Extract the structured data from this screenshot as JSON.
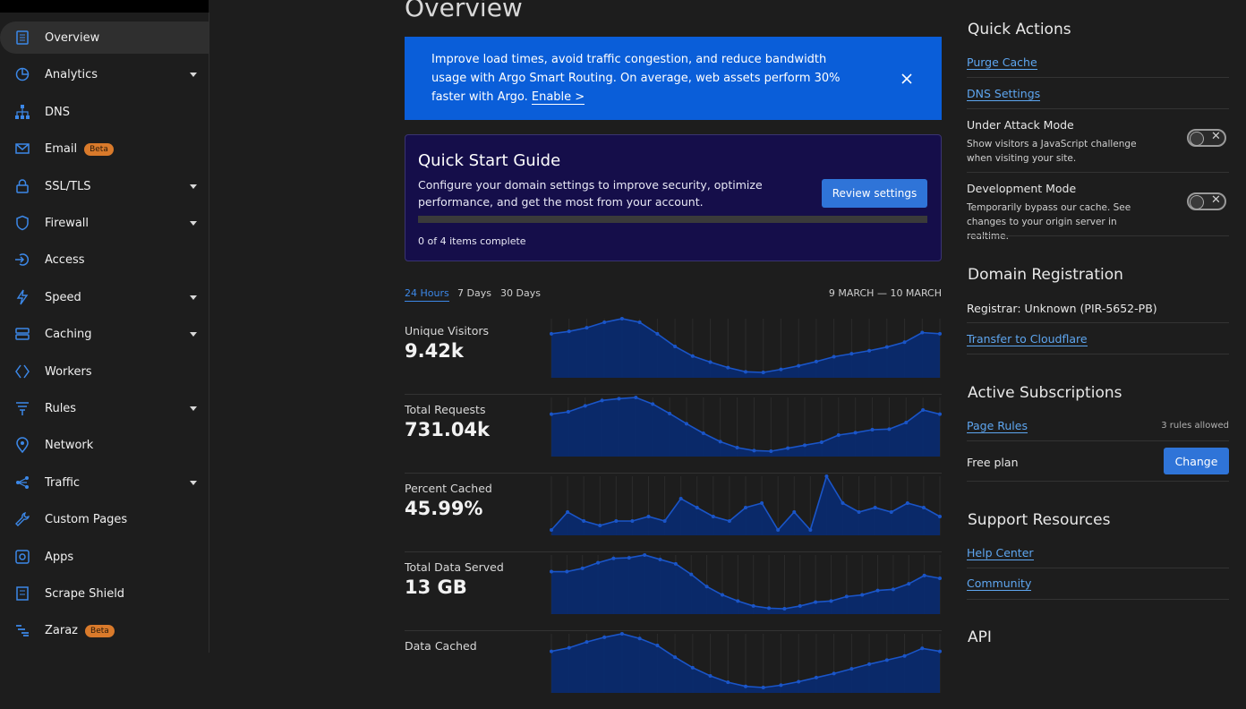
{
  "sidebar": {
    "items": [
      {
        "label": "Overview",
        "icon": "document-icon",
        "caret": false,
        "beta": "",
        "active": true
      },
      {
        "label": "Analytics",
        "icon": "pie-chart-icon",
        "caret": true,
        "beta": ""
      },
      {
        "label": "DNS",
        "icon": "network-tree-icon",
        "caret": false,
        "beta": ""
      },
      {
        "label": "Email",
        "icon": "envelope-icon",
        "caret": false,
        "beta": "Beta"
      },
      {
        "label": "SSL/TLS",
        "icon": "lock-icon",
        "caret": true,
        "beta": ""
      },
      {
        "label": "Firewall",
        "icon": "shield-icon",
        "caret": true,
        "beta": ""
      },
      {
        "label": "Access",
        "icon": "access-arrow-icon",
        "caret": false,
        "beta": ""
      },
      {
        "label": "Speed",
        "icon": "lightning-icon",
        "caret": true,
        "beta": ""
      },
      {
        "label": "Caching",
        "icon": "server-stack-icon",
        "caret": true,
        "beta": ""
      },
      {
        "label": "Workers",
        "icon": "diamond-code-icon",
        "caret": false,
        "beta": ""
      },
      {
        "label": "Rules",
        "icon": "filter-icon",
        "caret": true,
        "beta": ""
      },
      {
        "label": "Network",
        "icon": "location-pin-icon",
        "caret": false,
        "beta": ""
      },
      {
        "label": "Traffic",
        "icon": "share-nodes-icon",
        "caret": true,
        "beta": ""
      },
      {
        "label": "Custom Pages",
        "icon": "wrench-icon",
        "caret": false,
        "beta": ""
      },
      {
        "label": "Apps",
        "icon": "app-square-icon",
        "caret": false,
        "beta": ""
      },
      {
        "label": "Scrape Shield",
        "icon": "page-shield-icon",
        "caret": false,
        "beta": ""
      },
      {
        "label": "Zaraz",
        "icon": "zaraz-lines-icon",
        "caret": false,
        "beta": "Beta"
      }
    ]
  },
  "main": {
    "title": "Overview",
    "banner": {
      "text": "Improve load times, avoid traffic congestion, and reduce bandwidth usage with Argo Smart Routing. On average, web assets perform 30% faster with Argo.",
      "link": "Enable >"
    },
    "quick_start": {
      "title": "Quick Start Guide",
      "description": "Configure your domain settings to improve security, optimize performance, and get the most from your account.",
      "button": "Review settings",
      "progress_text": "0 of 4 items complete",
      "progress": 0
    },
    "tabs": [
      "24 Hours",
      "7 Days",
      "30 Days"
    ],
    "active_tab": 0,
    "date_range": "9 MARCH — 10 MARCH"
  },
  "chart_data": [
    {
      "type": "area",
      "title": "Unique Visitors",
      "value_label": "9.42k",
      "values": [
        75,
        79,
        85,
        94,
        100,
        94,
        75,
        54,
        38,
        28,
        19,
        12,
        11,
        16,
        22,
        29,
        37,
        42,
        47,
        53,
        61,
        77,
        75
      ]
    },
    {
      "type": "area",
      "title": "Total Requests",
      "value_label": "731.04k",
      "values": [
        72,
        76,
        86,
        95,
        98,
        100,
        89,
        73,
        56,
        40,
        26,
        16,
        11,
        10,
        15,
        20,
        25,
        37,
        41,
        46,
        47,
        58,
        79,
        72
      ]
    },
    {
      "type": "area",
      "title": "Percent Cached",
      "value_label": "45.99%",
      "values": [
        88,
        92,
        90,
        89,
        90,
        90,
        91,
        90,
        95,
        93,
        91,
        90,
        93,
        94,
        88,
        92,
        88,
        100,
        94,
        92,
        93,
        92,
        94,
        93,
        91
      ]
    },
    {
      "type": "area",
      "title": "Total Data Served",
      "value_label": "13 GB",
      "values": [
        70,
        70,
        76,
        86,
        94,
        95,
        100,
        92,
        84,
        65,
        43,
        28,
        17,
        8,
        4,
        3,
        8,
        15,
        17,
        25,
        28,
        36,
        38,
        48,
        63,
        58
      ]
    },
    {
      "type": "area",
      "title": "Data Cached",
      "value_label": "",
      "values": [
        70,
        76,
        86,
        94,
        100,
        92,
        80,
        60,
        42,
        28,
        17,
        10,
        8,
        12,
        18,
        25,
        32,
        40,
        48,
        55,
        62,
        75,
        70
      ]
    }
  ],
  "quick_actions": {
    "title": "Quick Actions",
    "links": [
      "Purge Cache",
      "DNS Settings"
    ],
    "under_attack": {
      "title": "Under Attack Mode",
      "desc": "Show visitors a JavaScript challenge when visiting your site.",
      "on": false
    },
    "dev_mode": {
      "title": "Development Mode",
      "desc": "Temporarily bypass our cache. See changes to your origin server in realtime.",
      "on": false
    }
  },
  "domain_registration": {
    "title": "Domain Registration",
    "registrar": "Registrar: Unknown (PIR-5652-PB)",
    "link": "Transfer to Cloudflare"
  },
  "active_subscriptions": {
    "title": "Active Subscriptions",
    "page_rules": "Page Rules",
    "page_rules_note": "3 rules allowed",
    "plan": "Free plan",
    "change_button": "Change"
  },
  "support": {
    "title": "Support Resources",
    "links": [
      "Help Center",
      "Community"
    ]
  },
  "api": {
    "title": "API"
  },
  "colors": {
    "accent": "#0a5ed9",
    "chart_fill": "#0a2a6e",
    "chart_line": "#1a55c8",
    "quick_start_bg": "#150e4a"
  }
}
